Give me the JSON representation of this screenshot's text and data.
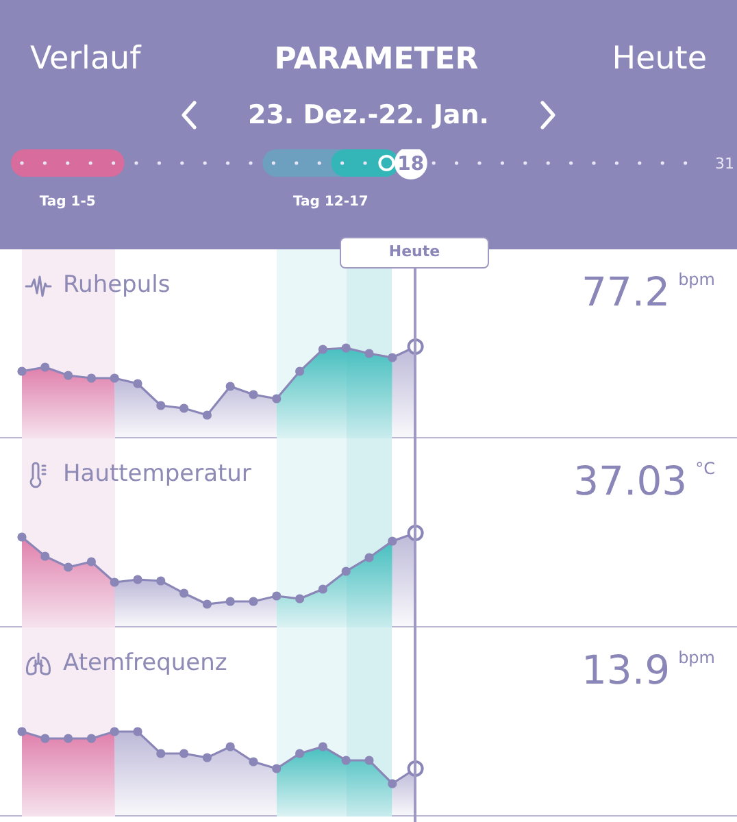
{
  "header": {
    "left_link": "Verlauf",
    "title": "PARAMETER",
    "right_link": "Heute"
  },
  "date_range": {
    "label": "23. Dez.-22. Jan."
  },
  "timeline": {
    "ranges": [
      {
        "label": "Tag 1-5",
        "kind": "period"
      },
      {
        "label": "Tag 12-17",
        "kind": "fertile"
      }
    ],
    "current_day": "18",
    "last_day": "31"
  },
  "today_tab": "Heute",
  "metrics": [
    {
      "name": "Ruhepuls",
      "kind": "pulse",
      "value": "77.2",
      "unit": "bpm"
    },
    {
      "name": "Hauttemperatur",
      "kind": "thermometer",
      "value": "37.03",
      "unit": "°C"
    },
    {
      "name": "Atemfrequenz",
      "kind": "lungs",
      "value": "13.9",
      "unit": "bpm"
    }
  ]
}
